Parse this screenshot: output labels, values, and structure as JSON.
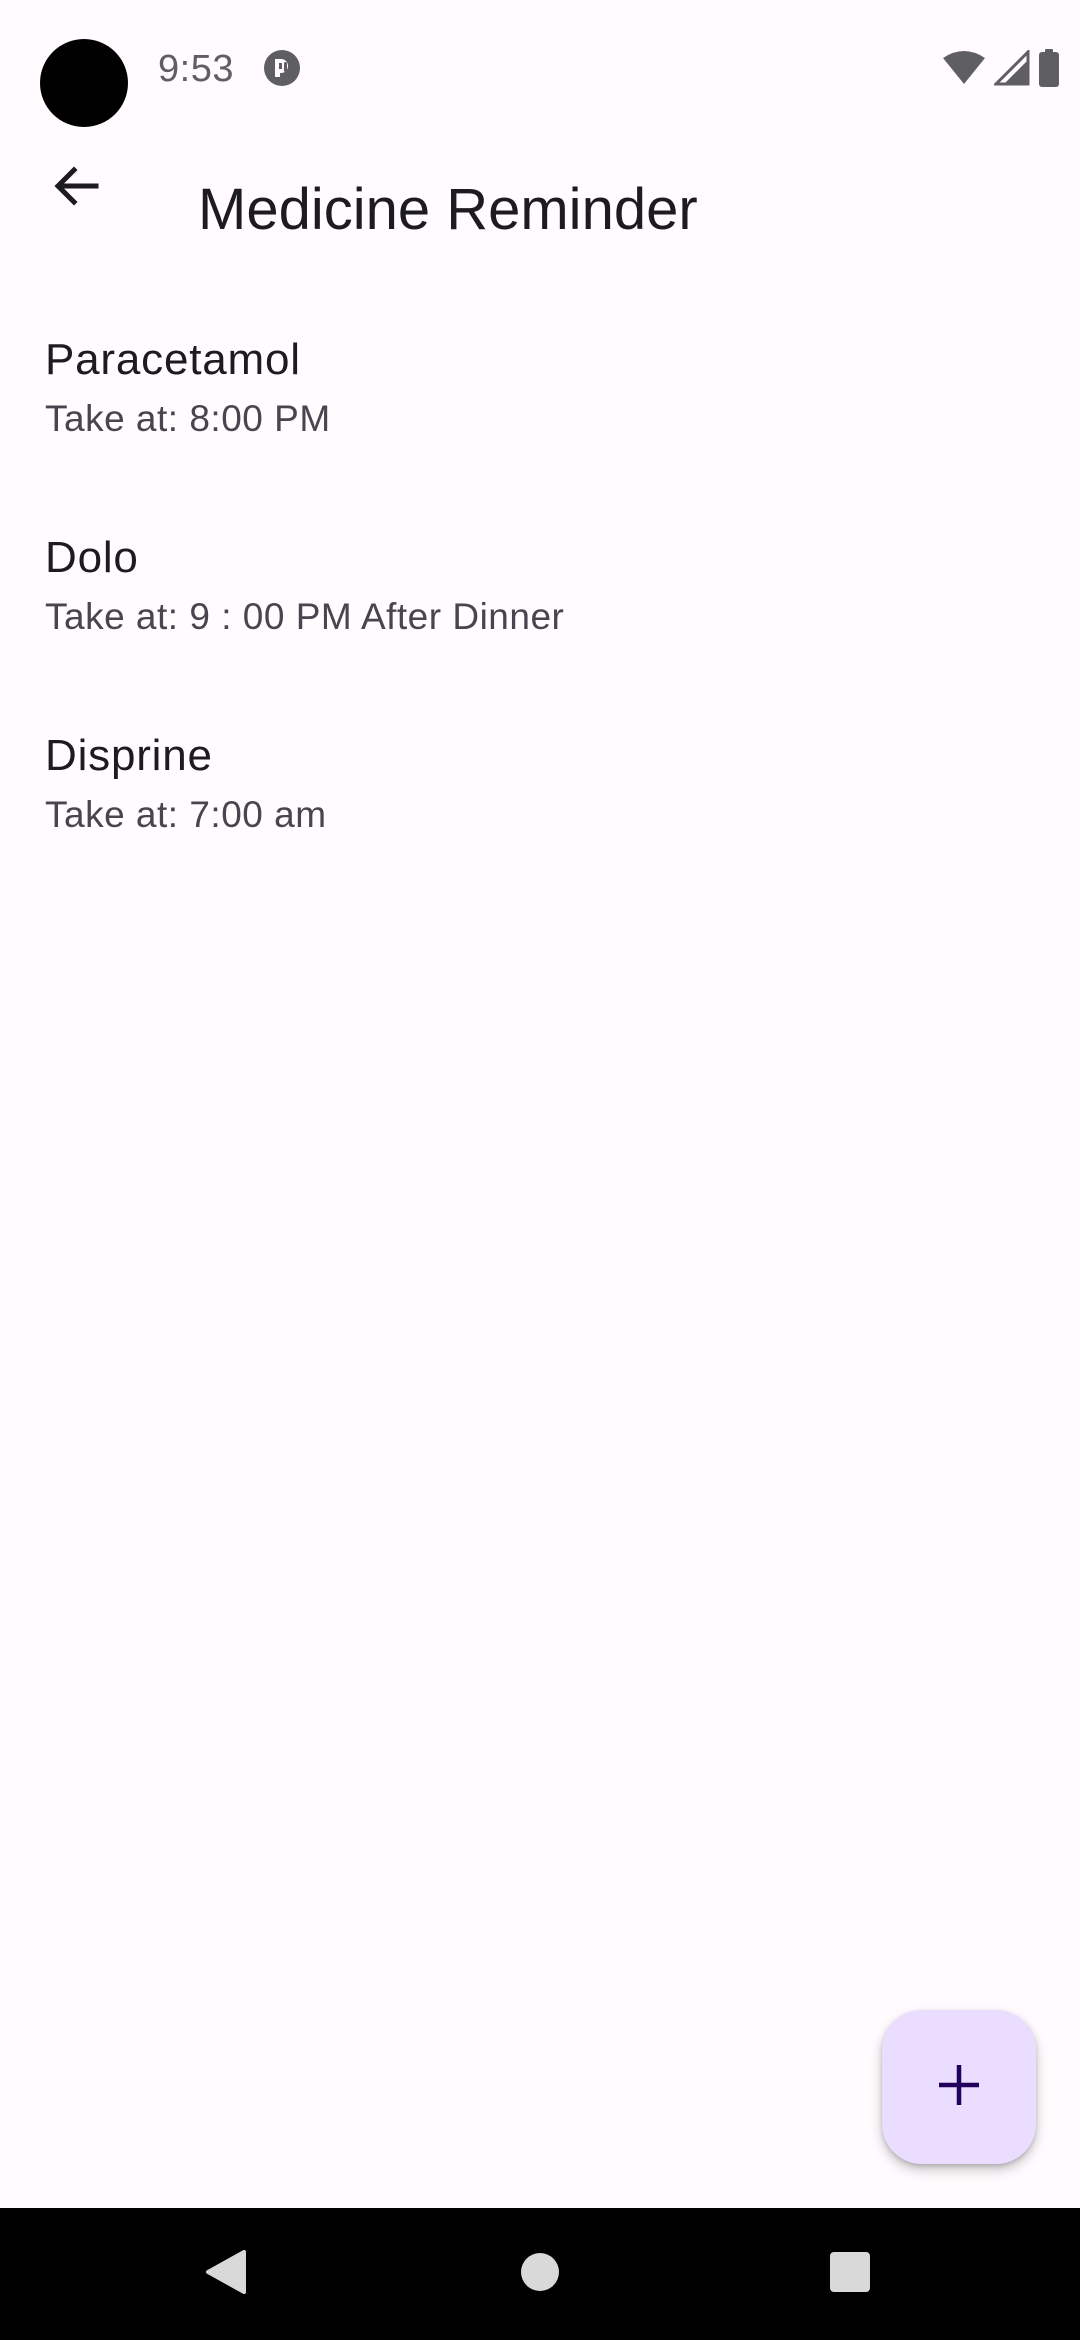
{
  "status_bar": {
    "time": "9:53",
    "icons": [
      "app-notification-icon",
      "wifi-icon",
      "cellular-signal-icon",
      "battery-icon"
    ]
  },
  "app_bar": {
    "title": "Medicine Reminder",
    "back_icon": "arrow-back-icon"
  },
  "medicines": [
    {
      "name": "Paracetamol",
      "time": "Take at: 8:00 PM"
    },
    {
      "name": "Dolo",
      "time": "Take at: 9 : 00 PM After Dinner"
    },
    {
      "name": "Disprine",
      "time": "Take at: 7:00 am"
    }
  ],
  "fab": {
    "icon": "add-icon"
  },
  "nav_bar": {
    "icons": [
      "nav-back-icon",
      "nav-home-icon",
      "nav-recents-icon"
    ]
  },
  "colors": {
    "background": "#FFFBFE",
    "fab_container": "#EADDFF",
    "fab_icon": "#21005D",
    "primary_text": "#1C1B1F",
    "secondary_text": "#49454F",
    "nav_bar": "#000000"
  }
}
